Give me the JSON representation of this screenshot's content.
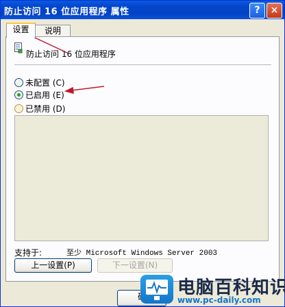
{
  "window": {
    "title": "防止访问 16 位应用程序 属性",
    "help_button": "?",
    "close_button": "×"
  },
  "tabs": [
    {
      "label": "设置",
      "active": true
    },
    {
      "label": "说明",
      "active": false
    }
  ],
  "policy": {
    "name": "防止访问 16 位应用程序",
    "icon": "policy-setting-icon"
  },
  "options": [
    {
      "label": "未配置 (C)",
      "checked": false
    },
    {
      "label": "已启用 (E)",
      "checked": true
    },
    {
      "label": "已禁用 (D)",
      "checked": false
    }
  ],
  "supported": {
    "label": "支持于:",
    "value": "至少 Microsoft Windows Server 2003"
  },
  "buttons": {
    "prev": "上一设置(P)",
    "next": "下一设置(N)",
    "ok": "确"
  },
  "watermark": {
    "name": "电脑百科知识",
    "url": "www.pc-daily.com"
  },
  "colors": {
    "title_bar": "#0446cd",
    "arrow": "#c0182b",
    "checked_dot": "#21a121"
  }
}
